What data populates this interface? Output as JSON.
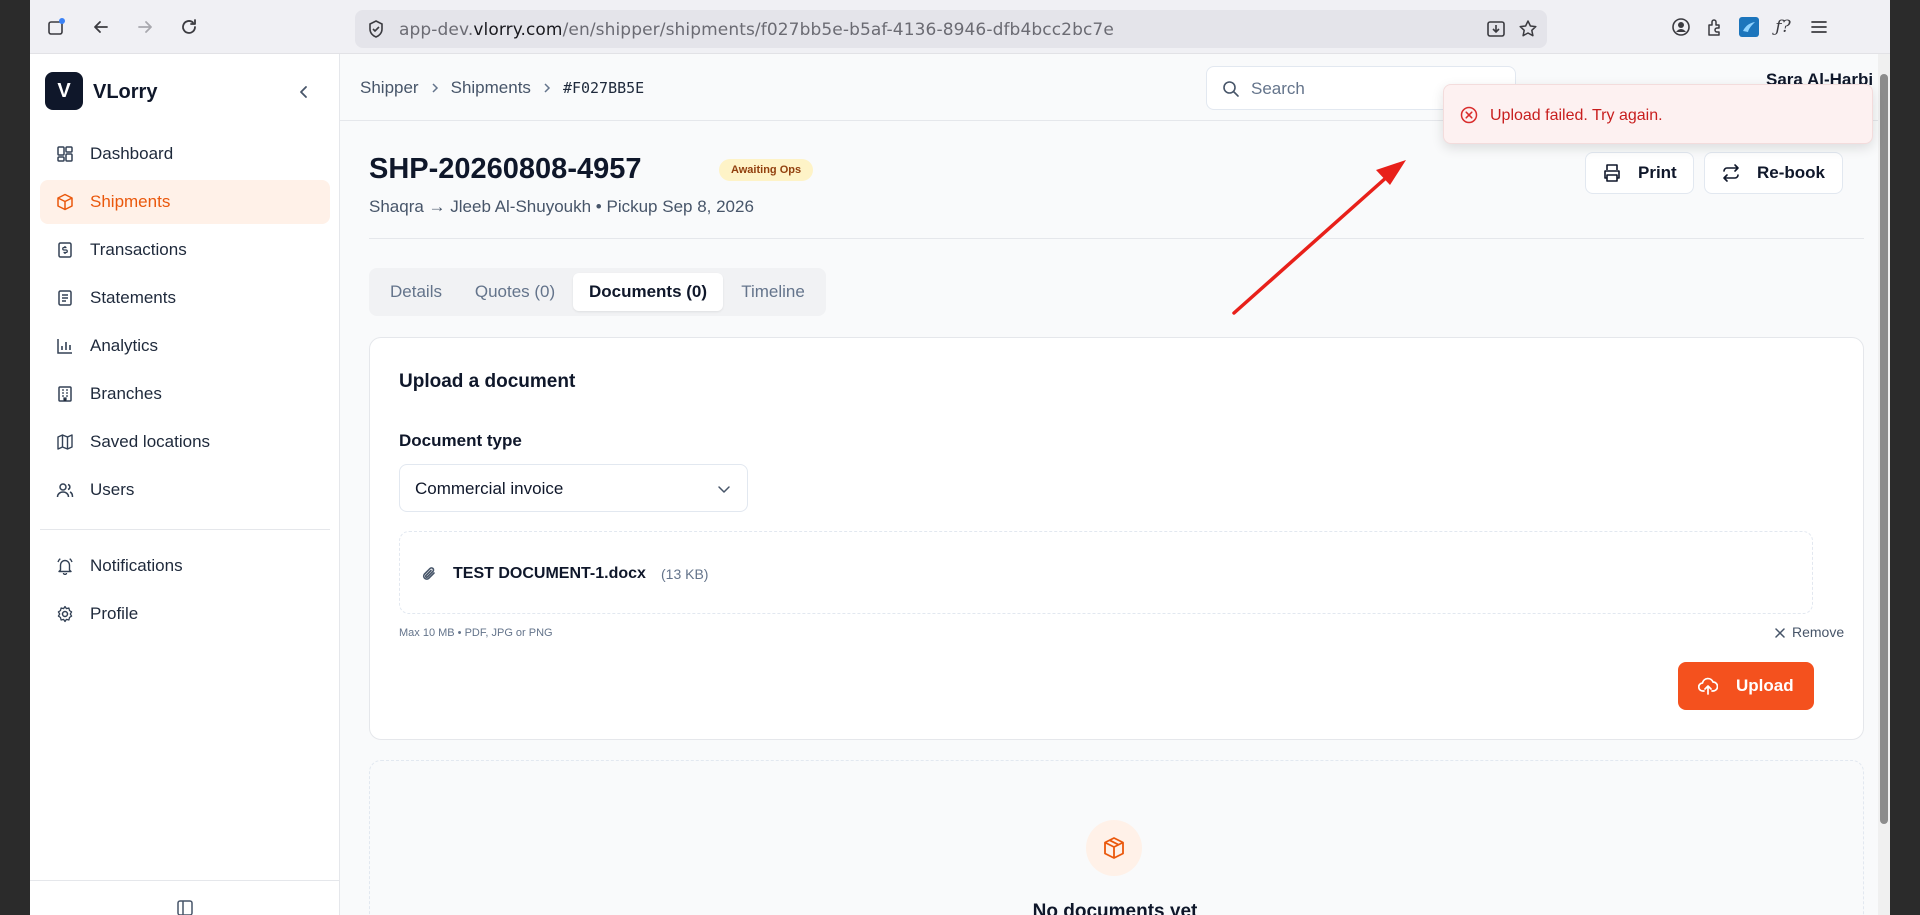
{
  "browser": {
    "url_prefix": "app-dev.",
    "url_domain": "vlorry.com",
    "url_path": "/en/shipper/shipments/f027bb5e-b5af-4136-8946-dfb4bcc2bc7e"
  },
  "sidebar": {
    "logo_letter": "V",
    "brand": "VLorry",
    "items": [
      {
        "label": "Dashboard",
        "icon": "dashboard-icon"
      },
      {
        "label": "Shipments",
        "icon": "box-icon",
        "active": true
      },
      {
        "label": "Transactions",
        "icon": "receipt-icon"
      },
      {
        "label": "Statements",
        "icon": "statement-icon"
      },
      {
        "label": "Analytics",
        "icon": "chart-icon"
      },
      {
        "label": "Branches",
        "icon": "building-icon"
      },
      {
        "label": "Saved locations",
        "icon": "map-icon"
      },
      {
        "label": "Users",
        "icon": "users-icon"
      }
    ],
    "secondary": [
      {
        "label": "Notifications",
        "icon": "bell-icon"
      },
      {
        "label": "Profile",
        "icon": "gear-icon"
      }
    ]
  },
  "topbar": {
    "breadcrumb": [
      "Shipper",
      "Shipments",
      "#F027BB5E"
    ],
    "search_placeholder": "Search",
    "user_name": "Sara Al-Harbi"
  },
  "shipment": {
    "id": "SHP-20260808-4957",
    "status": "Awaiting Ops",
    "subtitle": "Shaqra → Jleeb Al-Shuyoukh • Pickup Sep 8, 2026",
    "print_label": "Print",
    "rebook_label": "Re-book"
  },
  "tabs": [
    "Details",
    "Quotes (0)",
    "Documents (0)",
    "Timeline"
  ],
  "upload": {
    "title": "Upload a document",
    "type_label": "Document type",
    "type_value": "Commercial invoice",
    "file_name": "TEST DOCUMENT-1.docx",
    "file_size": "(13 KB)",
    "hint": "Max 10 MB • PDF, JPG or PNG",
    "remove_label": "Remove",
    "upload_label": "Upload"
  },
  "empty_state": {
    "title": "No documents yet"
  },
  "toast": {
    "message": "Upload failed. Try again."
  },
  "colors": {
    "accent": "#f4511e",
    "active_bg": "#fff1e8",
    "error": "#c81e1e",
    "annotation_arrow": "#e8201a"
  }
}
